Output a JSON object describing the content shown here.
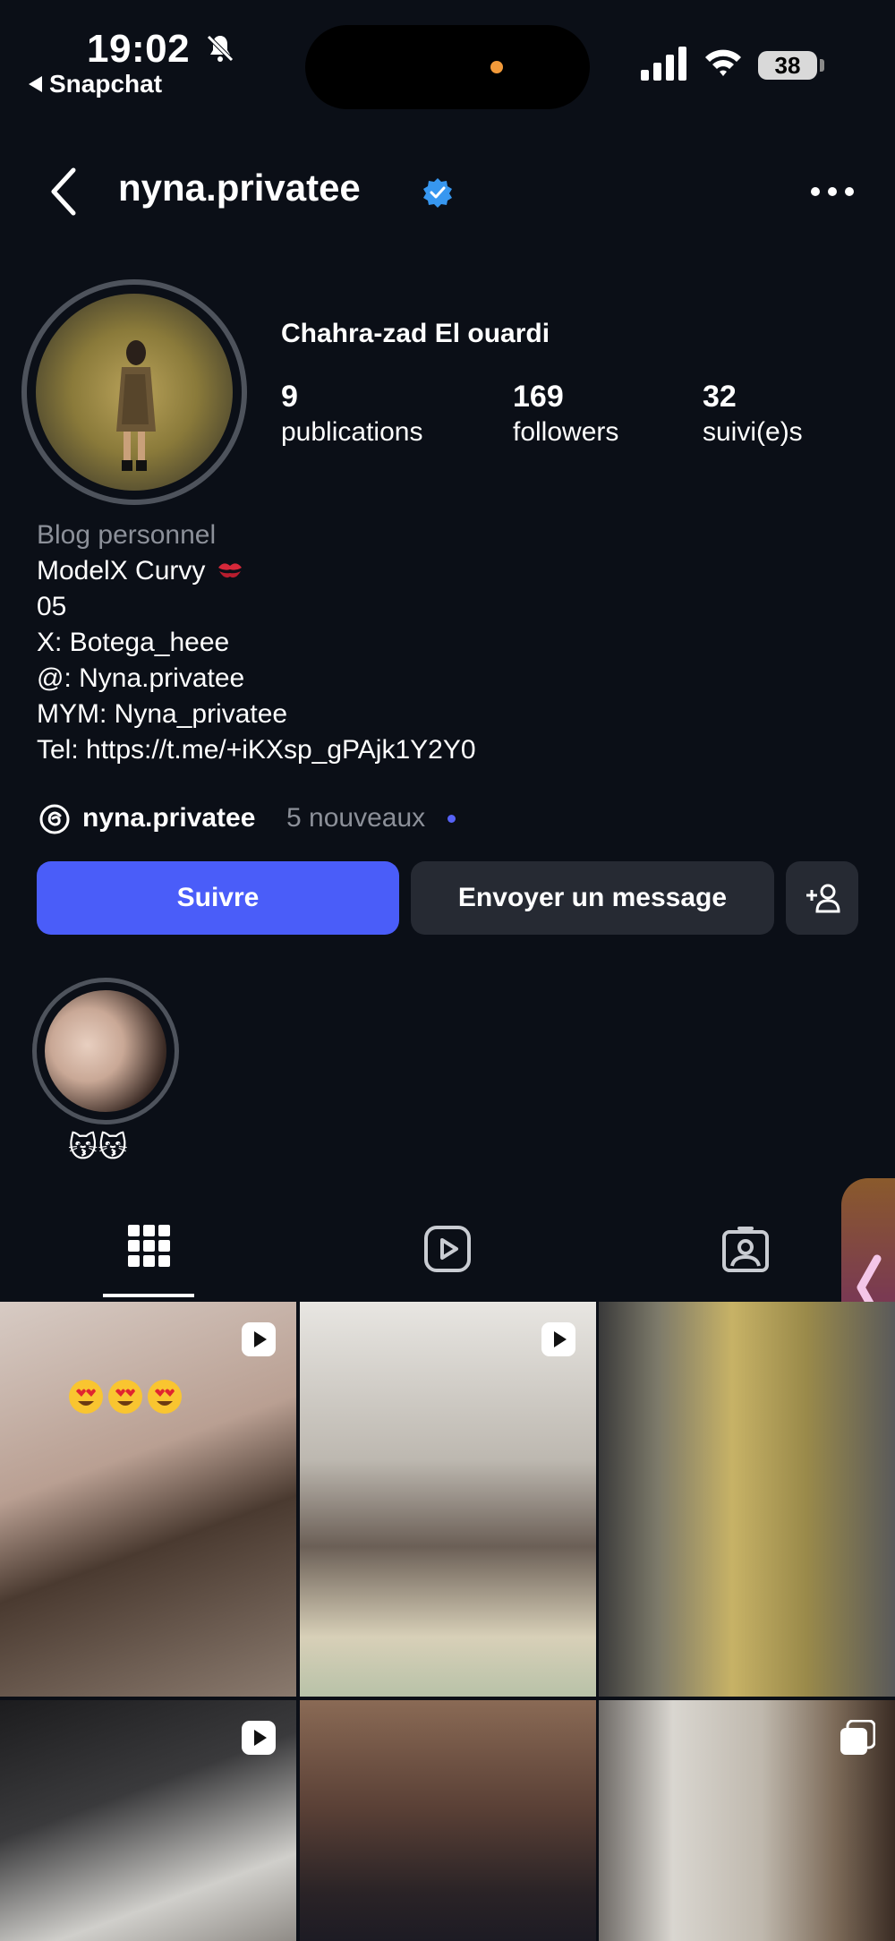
{
  "status_bar": {
    "time": "19:02",
    "back_app": "Snapchat",
    "battery": "38",
    "icons": [
      "bell-slash-icon",
      "cellular-signal-icon",
      "wifi-icon",
      "battery-icon"
    ]
  },
  "header": {
    "username": "nyna.privatee",
    "verified": true,
    "icons": [
      "back-chevron-icon",
      "verified-badge-icon",
      "more-dots-icon"
    ]
  },
  "profile": {
    "full_name": "Chahra-zad El ouardi",
    "stats": [
      {
        "value": "9",
        "label": "publications"
      },
      {
        "value": "169",
        "label": "followers"
      },
      {
        "value": "32",
        "label": "suivi(e)s"
      }
    ],
    "category": "Blog personnel",
    "bio_lines": [
      "ModelX Curvy",
      "05",
      "X: Botega_heee",
      "@: Nyna.privatee",
      "MYM: Nyna_privatee",
      "Tel: https://t.me/+iKXsp_gPAjk1Y2Y0"
    ],
    "threads": {
      "name": "nyna.privatee",
      "new_count": "5 nouveaux"
    }
  },
  "actions": {
    "follow": "Suivre",
    "message": "Envoyer un message",
    "add_user_icon": "add-person-icon"
  },
  "highlights": [
    {
      "label": "😽😽"
    }
  ],
  "tabs": [
    "grid-icon",
    "reels-icon",
    "tagged-icon"
  ],
  "accent_colors": {
    "follow_button": "#4a5df9",
    "verified": "#3797f0",
    "background": "#0b0f17",
    "secondary_button": "#262a33"
  },
  "posts": [
    {
      "type": "reel"
    },
    {
      "type": "reel"
    },
    {
      "type": "photo"
    },
    {
      "type": "reel"
    },
    {
      "type": "photo"
    },
    {
      "type": "carousel"
    }
  ]
}
